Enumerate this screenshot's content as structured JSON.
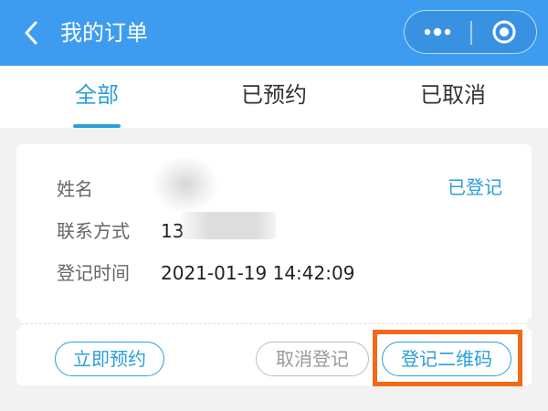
{
  "navbar": {
    "title": "我的订单",
    "back_icon": "chevron-left-icon",
    "more_icon": "more-dots-icon",
    "close_icon": "target-close-icon",
    "background": "#3d9cf0"
  },
  "tabs": [
    {
      "label": "全部",
      "active": true
    },
    {
      "label": "已预约",
      "active": false
    },
    {
      "label": "已取消",
      "active": false
    }
  ],
  "order": {
    "status": "已登记",
    "fields": [
      {
        "label": "姓名",
        "value": ""
      },
      {
        "label": "联系方式",
        "value": "13"
      },
      {
        "label": "登记时间",
        "value": "2021-01-19 14:42:09"
      }
    ],
    "actions": {
      "reserve": "立即预约",
      "cancel": "取消登记",
      "qrcode": "登记二维码"
    }
  },
  "colors": {
    "accent": "#2a9fd7",
    "highlight": "#f06a18",
    "disabled": "#bdbdbd"
  }
}
